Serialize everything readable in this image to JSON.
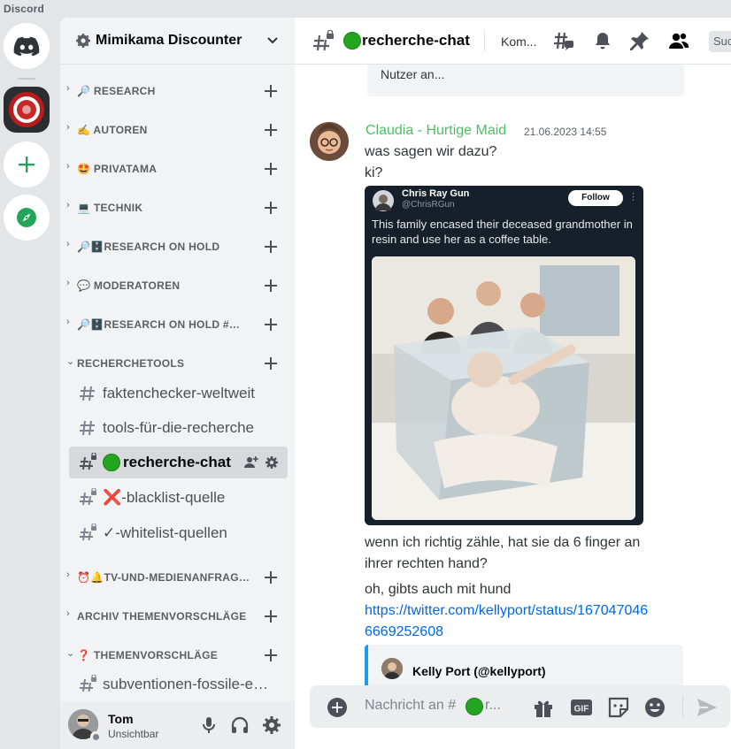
{
  "app": {
    "title": "Discord"
  },
  "server_rail": {
    "items": [
      {
        "name": "home",
        "icon": "discord-logo-icon"
      },
      {
        "name": "mimikama",
        "icon": "mimikama-server-icon"
      },
      {
        "name": "add-server",
        "icon": "plus-icon"
      },
      {
        "name": "explore",
        "icon": "compass-icon"
      }
    ]
  },
  "guild": {
    "name": "Mimikama Discounter"
  },
  "categories": [
    {
      "label": "🔎 RESEARCH",
      "arrow": "›"
    },
    {
      "label": "✍️ AUTOREN",
      "arrow": "›"
    },
    {
      "label": "🤩 PRIVATAMA",
      "arrow": "›"
    },
    {
      "label": "💻 TECHNIK",
      "arrow": "›"
    },
    {
      "label": "🔎🗄️RESEARCH ON HOLD",
      "arrow": "›"
    },
    {
      "label": "💬 MODERATOREN",
      "arrow": "›"
    },
    {
      "label": "🔎🗄️RESEARCH ON HOLD #MEDIEN",
      "arrow": "›"
    },
    {
      "label": "RECHERCHETOOLS",
      "arrow": "⌄"
    },
    {
      "label": "⏰🔔TV-UND-MEDIENANFRAGEN",
      "arrow": "›"
    },
    {
      "label": "ARCHIV THEMENVORSCHLÄGE",
      "arrow": "›"
    },
    {
      "label": "❓ THEMENVORSCHLÄGE",
      "arrow": "⌄"
    }
  ],
  "channels": [
    {
      "label": "faktenchecker-weltweit",
      "locked": false
    },
    {
      "label": "tools-für-die-recherche",
      "locked": false
    },
    {
      "label": "recherche-chat",
      "locked": true,
      "active": true
    },
    {
      "label": "❌-blacklist-quelle",
      "locked": true
    },
    {
      "label": "✓-whitelist-quellen",
      "locked": true
    },
    {
      "label": "subventionen-fossile-energien",
      "locked": true
    }
  ],
  "user": {
    "name": "Tom",
    "status": "Unsichtbar"
  },
  "header": {
    "channel": "recherche-chat",
    "topic": "Kom...",
    "search_placeholder": "Suc"
  },
  "messages": {
    "prev_embed_text": "Nutzer an...",
    "author": "Claudia - Hurtige Maid",
    "author_color": "#4fbf66",
    "timestamp": "21.06.2023 14:55",
    "lines": [
      "was sagen wir dazu?",
      "ki?"
    ],
    "tweet": {
      "name": "Chris Ray Gun",
      "handle": "@ChrisRGun",
      "follow": "Follow",
      "text": "This family encased their deceased grandmother in resin and use her as a coffee table."
    },
    "followups": [
      "wenn ich richtig zähle, hat sie da 6 finger an",
      "ihrer rechten hand?",
      "oh, gibts auch mit hund"
    ],
    "link_lines": [
      "https://twitter.com/kellyport/status/167047046",
      "6669252608"
    ],
    "link_embed_author": "Kelly Port (@kellyport)"
  },
  "composer": {
    "placeholder_prefix": "Nachricht an #",
    "placeholder_suffix": "r..."
  },
  "colors": {
    "accent": "#5865f2",
    "green": "#23a559",
    "link": "#0068e0"
  }
}
